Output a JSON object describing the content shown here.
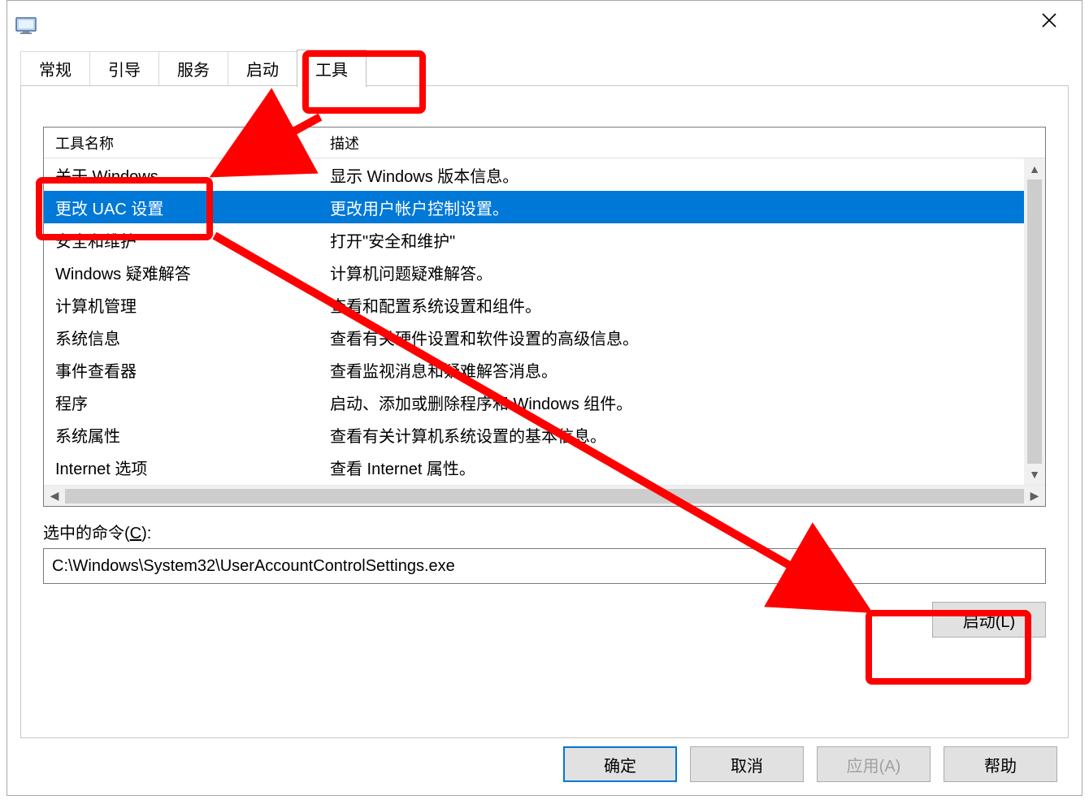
{
  "tabs": [
    "常规",
    "引导",
    "服务",
    "启动",
    "工具"
  ],
  "active_tab_index": 4,
  "columns": {
    "name": "工具名称",
    "desc": "描述"
  },
  "tools": [
    {
      "name": "关于 Windows",
      "desc": "显示 Windows 版本信息。"
    },
    {
      "name": "更改 UAC 设置",
      "desc": "更改用户帐户控制设置。",
      "selected": true
    },
    {
      "name": "安全和维护",
      "desc": "打开\"安全和维护\""
    },
    {
      "name": "Windows 疑难解答",
      "desc": "计算机问题疑难解答。"
    },
    {
      "name": "计算机管理",
      "desc": "查看和配置系统设置和组件。"
    },
    {
      "name": "系统信息",
      "desc": "查看有关硬件设置和软件设置的高级信息。"
    },
    {
      "name": "事件查看器",
      "desc": "查看监视消息和疑难解答消息。"
    },
    {
      "name": "程序",
      "desc": "启动、添加或删除程序和 Windows 组件。"
    },
    {
      "name": "系统属性",
      "desc": "查看有关计算机系统设置的基本信息。"
    },
    {
      "name": "Internet 选项",
      "desc": "查看 Internet 属性。"
    }
  ],
  "command_label_prefix": "选中的命令(",
  "command_label_hotkey": "C",
  "command_label_suffix": "):",
  "command_value": "C:\\Windows\\System32\\UserAccountControlSettings.exe",
  "launch_button": "启动(L)",
  "buttons": {
    "ok": "确定",
    "cancel": "取消",
    "apply": "应用(A)",
    "help": "帮助"
  }
}
